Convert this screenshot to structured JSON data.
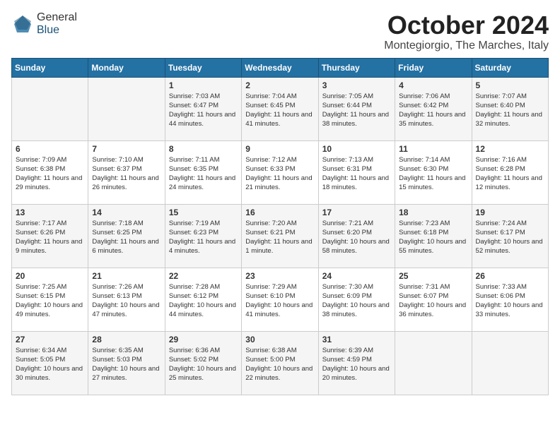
{
  "header": {
    "logo_general": "General",
    "logo_blue": "Blue",
    "month_title": "October 2024",
    "location": "Montegiorgio, The Marches, Italy"
  },
  "days_of_week": [
    "Sunday",
    "Monday",
    "Tuesday",
    "Wednesday",
    "Thursday",
    "Friday",
    "Saturday"
  ],
  "weeks": [
    [
      {
        "day": "",
        "info": ""
      },
      {
        "day": "",
        "info": ""
      },
      {
        "day": "1",
        "info": "Sunrise: 7:03 AM\nSunset: 6:47 PM\nDaylight: 11 hours and 44 minutes."
      },
      {
        "day": "2",
        "info": "Sunrise: 7:04 AM\nSunset: 6:45 PM\nDaylight: 11 hours and 41 minutes."
      },
      {
        "day": "3",
        "info": "Sunrise: 7:05 AM\nSunset: 6:44 PM\nDaylight: 11 hours and 38 minutes."
      },
      {
        "day": "4",
        "info": "Sunrise: 7:06 AM\nSunset: 6:42 PM\nDaylight: 11 hours and 35 minutes."
      },
      {
        "day": "5",
        "info": "Sunrise: 7:07 AM\nSunset: 6:40 PM\nDaylight: 11 hours and 32 minutes."
      }
    ],
    [
      {
        "day": "6",
        "info": "Sunrise: 7:09 AM\nSunset: 6:38 PM\nDaylight: 11 hours and 29 minutes."
      },
      {
        "day": "7",
        "info": "Sunrise: 7:10 AM\nSunset: 6:37 PM\nDaylight: 11 hours and 26 minutes."
      },
      {
        "day": "8",
        "info": "Sunrise: 7:11 AM\nSunset: 6:35 PM\nDaylight: 11 hours and 24 minutes."
      },
      {
        "day": "9",
        "info": "Sunrise: 7:12 AM\nSunset: 6:33 PM\nDaylight: 11 hours and 21 minutes."
      },
      {
        "day": "10",
        "info": "Sunrise: 7:13 AM\nSunset: 6:31 PM\nDaylight: 11 hours and 18 minutes."
      },
      {
        "day": "11",
        "info": "Sunrise: 7:14 AM\nSunset: 6:30 PM\nDaylight: 11 hours and 15 minutes."
      },
      {
        "day": "12",
        "info": "Sunrise: 7:16 AM\nSunset: 6:28 PM\nDaylight: 11 hours and 12 minutes."
      }
    ],
    [
      {
        "day": "13",
        "info": "Sunrise: 7:17 AM\nSunset: 6:26 PM\nDaylight: 11 hours and 9 minutes."
      },
      {
        "day": "14",
        "info": "Sunrise: 7:18 AM\nSunset: 6:25 PM\nDaylight: 11 hours and 6 minutes."
      },
      {
        "day": "15",
        "info": "Sunrise: 7:19 AM\nSunset: 6:23 PM\nDaylight: 11 hours and 4 minutes."
      },
      {
        "day": "16",
        "info": "Sunrise: 7:20 AM\nSunset: 6:21 PM\nDaylight: 11 hours and 1 minute."
      },
      {
        "day": "17",
        "info": "Sunrise: 7:21 AM\nSunset: 6:20 PM\nDaylight: 10 hours and 58 minutes."
      },
      {
        "day": "18",
        "info": "Sunrise: 7:23 AM\nSunset: 6:18 PM\nDaylight: 10 hours and 55 minutes."
      },
      {
        "day": "19",
        "info": "Sunrise: 7:24 AM\nSunset: 6:17 PM\nDaylight: 10 hours and 52 minutes."
      }
    ],
    [
      {
        "day": "20",
        "info": "Sunrise: 7:25 AM\nSunset: 6:15 PM\nDaylight: 10 hours and 49 minutes."
      },
      {
        "day": "21",
        "info": "Sunrise: 7:26 AM\nSunset: 6:13 PM\nDaylight: 10 hours and 47 minutes."
      },
      {
        "day": "22",
        "info": "Sunrise: 7:28 AM\nSunset: 6:12 PM\nDaylight: 10 hours and 44 minutes."
      },
      {
        "day": "23",
        "info": "Sunrise: 7:29 AM\nSunset: 6:10 PM\nDaylight: 10 hours and 41 minutes."
      },
      {
        "day": "24",
        "info": "Sunrise: 7:30 AM\nSunset: 6:09 PM\nDaylight: 10 hours and 38 minutes."
      },
      {
        "day": "25",
        "info": "Sunrise: 7:31 AM\nSunset: 6:07 PM\nDaylight: 10 hours and 36 minutes."
      },
      {
        "day": "26",
        "info": "Sunrise: 7:33 AM\nSunset: 6:06 PM\nDaylight: 10 hours and 33 minutes."
      }
    ],
    [
      {
        "day": "27",
        "info": "Sunrise: 6:34 AM\nSunset: 5:05 PM\nDaylight: 10 hours and 30 minutes."
      },
      {
        "day": "28",
        "info": "Sunrise: 6:35 AM\nSunset: 5:03 PM\nDaylight: 10 hours and 27 minutes."
      },
      {
        "day": "29",
        "info": "Sunrise: 6:36 AM\nSunset: 5:02 PM\nDaylight: 10 hours and 25 minutes."
      },
      {
        "day": "30",
        "info": "Sunrise: 6:38 AM\nSunset: 5:00 PM\nDaylight: 10 hours and 22 minutes."
      },
      {
        "day": "31",
        "info": "Sunrise: 6:39 AM\nSunset: 4:59 PM\nDaylight: 10 hours and 20 minutes."
      },
      {
        "day": "",
        "info": ""
      },
      {
        "day": "",
        "info": ""
      }
    ]
  ]
}
